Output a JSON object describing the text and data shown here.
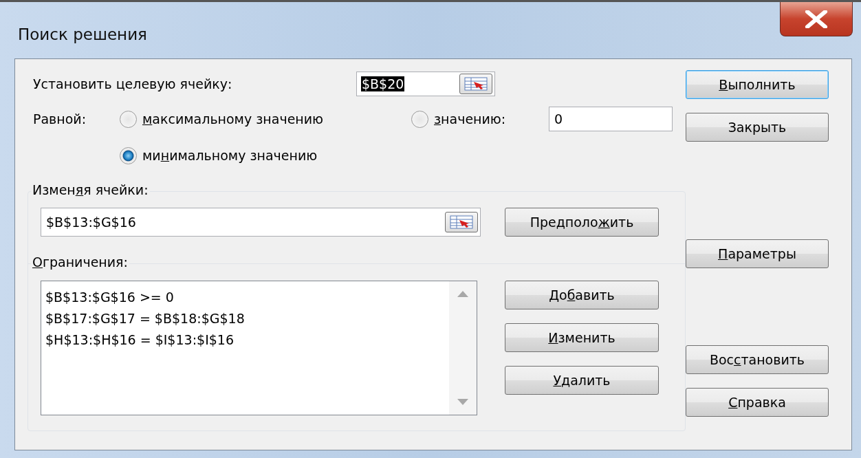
{
  "window": {
    "title": "Поиск решения"
  },
  "target": {
    "label": "Установить целевую ячейку:",
    "value": "$B$20",
    "text_selected": true
  },
  "equal_to": {
    "label": "Равной:",
    "value": "0",
    "options": [
      {
        "hotkey": "м",
        "after": "аксимальному значению",
        "selected": false
      },
      {
        "hotkey": "з",
        "after": "начению:",
        "selected": false
      },
      {
        "before": "ми",
        "hotkey": "н",
        "after": "имальному значению",
        "selected": true
      }
    ]
  },
  "changing": {
    "label": {
      "before": "Измен",
      "hotkey": "я",
      "after": "я ячейки:"
    },
    "value": "$B$13:$G$16",
    "button": {
      "before": "Предполо",
      "hotkey": "ж",
      "after": "ить"
    }
  },
  "constraints": {
    "label": {
      "hotkey": "О",
      "after": "граничения:"
    },
    "items": [
      "$B$13:$G$16 >= 0",
      "$B$17:$G$17 = $B$18:$G$18",
      "$H$13:$H$16 = $I$13:$I$16"
    ],
    "buttons": [
      {
        "before": "До",
        "hotkey": "б",
        "after": "авить"
      },
      {
        "hotkey": "И",
        "after": "зменить"
      },
      {
        "hotkey": "У",
        "after": "далить"
      }
    ]
  },
  "side_buttons": [
    {
      "hotkey": "В",
      "after": "ыполнить",
      "default": true
    },
    {
      "before": "Закрыть",
      "default": false
    },
    {
      "hotkey": "П",
      "after": "араметры",
      "default": false
    },
    {
      "before": "Вос",
      "hotkey": "с",
      "after": "тановить",
      "default": false
    },
    {
      "hotkey": "С",
      "after": "правка",
      "default": false
    }
  ]
}
